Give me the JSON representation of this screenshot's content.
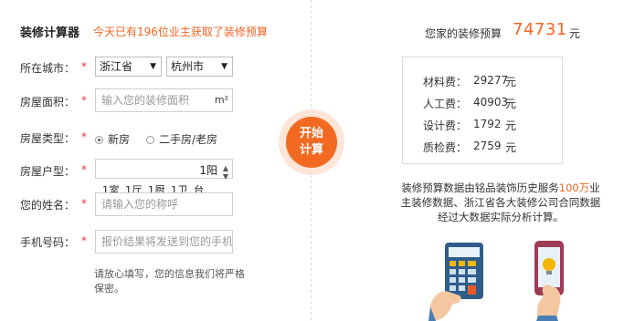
{
  "header": {
    "title": "装修计算器",
    "subtitle": "今天已有196位业主获取了装修预算"
  },
  "form": {
    "city": {
      "label": "所在城市：",
      "required": "*",
      "province": "浙江省",
      "city": "杭州市"
    },
    "area": {
      "label": "房屋面积：",
      "required": "*",
      "placeholder": "输入您的装修面积",
      "unit": "m²"
    },
    "house_type": {
      "label": "房屋类型：",
      "required": "*",
      "options": [
        "新房",
        "二手房/老房"
      ],
      "selected": "新房"
    },
    "layout": {
      "label": "房屋户型：",
      "required": "*",
      "value": "1阳",
      "rooms_text": "1室 1厅 1厨 1卫 台"
    },
    "name": {
      "label": "您的姓名：",
      "required": "*",
      "placeholder": "请输入您的称呼"
    },
    "phone": {
      "label": "手机号码：",
      "required": "*",
      "placeholder": "报价结果将发送到您的手机"
    },
    "privacy_note": "请放心填写，您的信息我们将严格保密。"
  },
  "start_button": {
    "line1": "开始",
    "line2": "计算"
  },
  "result": {
    "budget_label": "您家的装修预算",
    "budget_value": "74731",
    "budget_unit": "元",
    "breakdown": [
      {
        "label": "材料费：",
        "value": "29277",
        "unit": "元"
      },
      {
        "label": "人工费：",
        "value": "40903",
        "unit": "元"
      },
      {
        "label": "设计费：",
        "value": "1792",
        "unit": "元"
      },
      {
        "label": "质检费：",
        "value": "2759",
        "unit": "元"
      }
    ],
    "desc_before": "装修预算数据由铭品装饰历史服务",
    "desc_highlight": "100万",
    "desc_after": "业主装修数据、浙江省各大装修公司合同数据经过大数据实际分析计算。"
  },
  "colors": {
    "accent": "#f26522",
    "required": "#e53935",
    "button": "#f26a22"
  },
  "icons": {
    "calculator": "calculator-illustration",
    "phone": "phone-illustration"
  }
}
